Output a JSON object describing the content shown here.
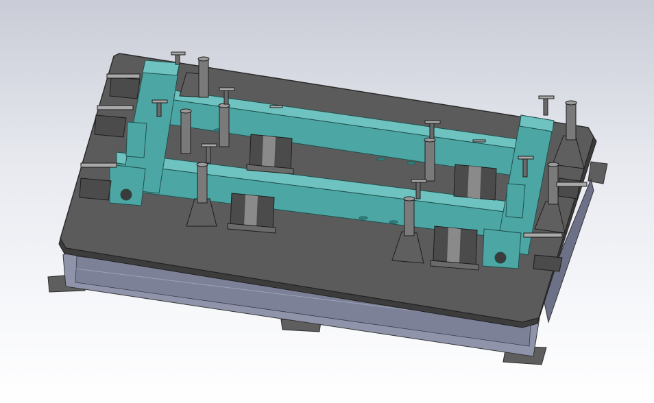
{
  "viewport": {
    "background_top": "#c9ccd6",
    "background_bottom": "#ffffff"
  },
  "model": {
    "description_hidden": "",
    "colors": {
      "plate": "#595959",
      "plate_edge": "#3c3c3c",
      "frame": "#4ca6a3",
      "frame_dark": "#2f7e7b",
      "frame_light": "#6ec2bf",
      "base_side": "#8e93a8",
      "base_side_dark": "#6d7187",
      "steel": "#a9a9a9",
      "steel_dark": "#4b4b4b",
      "foot": "#5f5f5f"
    }
  }
}
